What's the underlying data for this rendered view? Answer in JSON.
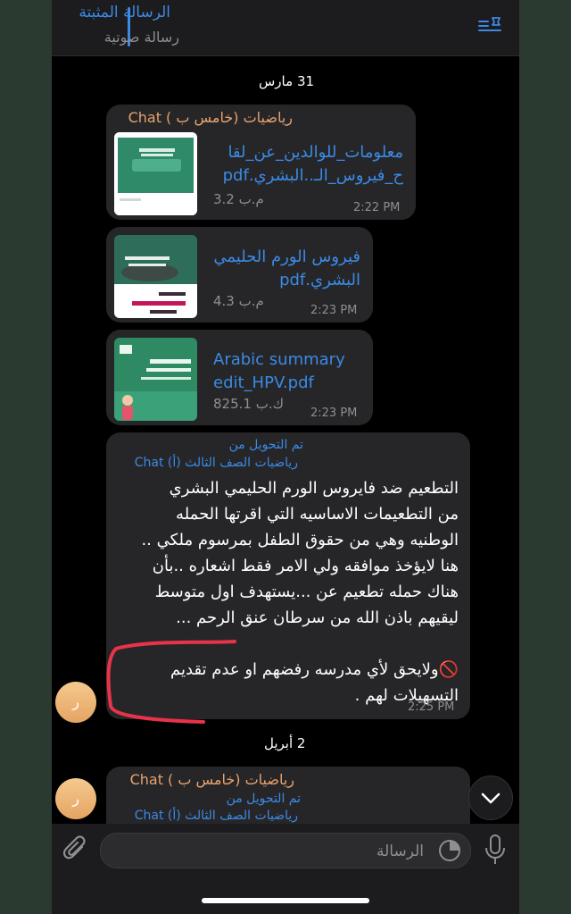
{
  "pinned": {
    "title": "الرسالة المثبتة",
    "subtitle": "رسالة صوتية",
    "icon": "pin-list-icon"
  },
  "dates": {
    "first": "31 مارس",
    "second": "2 أبريل"
  },
  "files": [
    {
      "sender": "رياضيات (خامس ب ) Chat",
      "name_line1": "معلومات_للوالدين_عن_لقا",
      "name_line2": "ح_فيروس_الـ..البشري.pdf",
      "size": "3.2 م.ب",
      "time": "2:22 PM"
    },
    {
      "name_line1": "فيروس الورم الحليمي",
      "name_line2": "البشري.pdf",
      "size": "4.3 م.ب",
      "time": "2:23 PM"
    },
    {
      "name_line1": "Arabic summary",
      "name_line2": "edit_HPV.pdf",
      "size": "825.1 ك.ب",
      "time": "2:23 PM"
    }
  ],
  "forwarded_message": {
    "label": "تم التحويل من",
    "from": "رياضيات الصف الثالث (أ) Chat",
    "lines": [
      "التطعيم ضد فايروس الورم الحليمي البشري",
      "من التطعيمات الاساسيه التي اقرتها الحمله",
      "الوطنيه وهي من حقوق الطفل بمرسوم ملكي ..",
      "هنا لايؤخذ موافقه ولي الامر فقط اشعاره ..بأن",
      "هناك حمله تطعيم عن ...يستهدف اول متوسط",
      "ليقيهم باذن الله من سرطان عنق الرحم ...",
      "🚫ولايحق لأي مدرسه رفضهم او عدم تقديم",
      "التسهيلات لهم ."
    ],
    "time": "2:25 PM"
  },
  "last_message": {
    "sender": "رياضيات (خامس ب ) Chat",
    "label": "تم التحويل من",
    "from": "رياضيات الصف الثالث (أ) Chat"
  },
  "avatar_letter": "ر",
  "input": {
    "placeholder": "الرسالة"
  },
  "colors": {
    "accent": "#3b8ae6",
    "sender": "#e8a26d",
    "bubble": "#262628",
    "annotation": "#e8334a"
  }
}
